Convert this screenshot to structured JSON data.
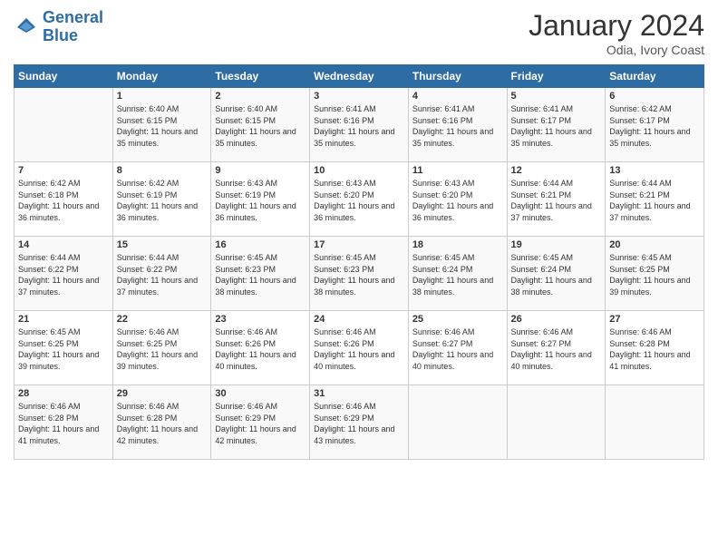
{
  "logo": {
    "line1": "General",
    "line2": "Blue"
  },
  "title": "January 2024",
  "subtitle": "Odia, Ivory Coast",
  "days": [
    "Sunday",
    "Monday",
    "Tuesday",
    "Wednesday",
    "Thursday",
    "Friday",
    "Saturday"
  ],
  "weeks": [
    [
      {
        "num": "",
        "sunrise": "",
        "sunset": "",
        "daylight": ""
      },
      {
        "num": "1",
        "sunrise": "Sunrise: 6:40 AM",
        "sunset": "Sunset: 6:15 PM",
        "daylight": "Daylight: 11 hours and 35 minutes."
      },
      {
        "num": "2",
        "sunrise": "Sunrise: 6:40 AM",
        "sunset": "Sunset: 6:15 PM",
        "daylight": "Daylight: 11 hours and 35 minutes."
      },
      {
        "num": "3",
        "sunrise": "Sunrise: 6:41 AM",
        "sunset": "Sunset: 6:16 PM",
        "daylight": "Daylight: 11 hours and 35 minutes."
      },
      {
        "num": "4",
        "sunrise": "Sunrise: 6:41 AM",
        "sunset": "Sunset: 6:16 PM",
        "daylight": "Daylight: 11 hours and 35 minutes."
      },
      {
        "num": "5",
        "sunrise": "Sunrise: 6:41 AM",
        "sunset": "Sunset: 6:17 PM",
        "daylight": "Daylight: 11 hours and 35 minutes."
      },
      {
        "num": "6",
        "sunrise": "Sunrise: 6:42 AM",
        "sunset": "Sunset: 6:17 PM",
        "daylight": "Daylight: 11 hours and 35 minutes."
      }
    ],
    [
      {
        "num": "7",
        "sunrise": "Sunrise: 6:42 AM",
        "sunset": "Sunset: 6:18 PM",
        "daylight": "Daylight: 11 hours and 36 minutes."
      },
      {
        "num": "8",
        "sunrise": "Sunrise: 6:42 AM",
        "sunset": "Sunset: 6:19 PM",
        "daylight": "Daylight: 11 hours and 36 minutes."
      },
      {
        "num": "9",
        "sunrise": "Sunrise: 6:43 AM",
        "sunset": "Sunset: 6:19 PM",
        "daylight": "Daylight: 11 hours and 36 minutes."
      },
      {
        "num": "10",
        "sunrise": "Sunrise: 6:43 AM",
        "sunset": "Sunset: 6:20 PM",
        "daylight": "Daylight: 11 hours and 36 minutes."
      },
      {
        "num": "11",
        "sunrise": "Sunrise: 6:43 AM",
        "sunset": "Sunset: 6:20 PM",
        "daylight": "Daylight: 11 hours and 36 minutes."
      },
      {
        "num": "12",
        "sunrise": "Sunrise: 6:44 AM",
        "sunset": "Sunset: 6:21 PM",
        "daylight": "Daylight: 11 hours and 37 minutes."
      },
      {
        "num": "13",
        "sunrise": "Sunrise: 6:44 AM",
        "sunset": "Sunset: 6:21 PM",
        "daylight": "Daylight: 11 hours and 37 minutes."
      }
    ],
    [
      {
        "num": "14",
        "sunrise": "Sunrise: 6:44 AM",
        "sunset": "Sunset: 6:22 PM",
        "daylight": "Daylight: 11 hours and 37 minutes."
      },
      {
        "num": "15",
        "sunrise": "Sunrise: 6:44 AM",
        "sunset": "Sunset: 6:22 PM",
        "daylight": "Daylight: 11 hours and 37 minutes."
      },
      {
        "num": "16",
        "sunrise": "Sunrise: 6:45 AM",
        "sunset": "Sunset: 6:23 PM",
        "daylight": "Daylight: 11 hours and 38 minutes."
      },
      {
        "num": "17",
        "sunrise": "Sunrise: 6:45 AM",
        "sunset": "Sunset: 6:23 PM",
        "daylight": "Daylight: 11 hours and 38 minutes."
      },
      {
        "num": "18",
        "sunrise": "Sunrise: 6:45 AM",
        "sunset": "Sunset: 6:24 PM",
        "daylight": "Daylight: 11 hours and 38 minutes."
      },
      {
        "num": "19",
        "sunrise": "Sunrise: 6:45 AM",
        "sunset": "Sunset: 6:24 PM",
        "daylight": "Daylight: 11 hours and 38 minutes."
      },
      {
        "num": "20",
        "sunrise": "Sunrise: 6:45 AM",
        "sunset": "Sunset: 6:25 PM",
        "daylight": "Daylight: 11 hours and 39 minutes."
      }
    ],
    [
      {
        "num": "21",
        "sunrise": "Sunrise: 6:45 AM",
        "sunset": "Sunset: 6:25 PM",
        "daylight": "Daylight: 11 hours and 39 minutes."
      },
      {
        "num": "22",
        "sunrise": "Sunrise: 6:46 AM",
        "sunset": "Sunset: 6:25 PM",
        "daylight": "Daylight: 11 hours and 39 minutes."
      },
      {
        "num": "23",
        "sunrise": "Sunrise: 6:46 AM",
        "sunset": "Sunset: 6:26 PM",
        "daylight": "Daylight: 11 hours and 40 minutes."
      },
      {
        "num": "24",
        "sunrise": "Sunrise: 6:46 AM",
        "sunset": "Sunset: 6:26 PM",
        "daylight": "Daylight: 11 hours and 40 minutes."
      },
      {
        "num": "25",
        "sunrise": "Sunrise: 6:46 AM",
        "sunset": "Sunset: 6:27 PM",
        "daylight": "Daylight: 11 hours and 40 minutes."
      },
      {
        "num": "26",
        "sunrise": "Sunrise: 6:46 AM",
        "sunset": "Sunset: 6:27 PM",
        "daylight": "Daylight: 11 hours and 40 minutes."
      },
      {
        "num": "27",
        "sunrise": "Sunrise: 6:46 AM",
        "sunset": "Sunset: 6:28 PM",
        "daylight": "Daylight: 11 hours and 41 minutes."
      }
    ],
    [
      {
        "num": "28",
        "sunrise": "Sunrise: 6:46 AM",
        "sunset": "Sunset: 6:28 PM",
        "daylight": "Daylight: 11 hours and 41 minutes."
      },
      {
        "num": "29",
        "sunrise": "Sunrise: 6:46 AM",
        "sunset": "Sunset: 6:28 PM",
        "daylight": "Daylight: 11 hours and 42 minutes."
      },
      {
        "num": "30",
        "sunrise": "Sunrise: 6:46 AM",
        "sunset": "Sunset: 6:29 PM",
        "daylight": "Daylight: 11 hours and 42 minutes."
      },
      {
        "num": "31",
        "sunrise": "Sunrise: 6:46 AM",
        "sunset": "Sunset: 6:29 PM",
        "daylight": "Daylight: 11 hours and 43 minutes."
      },
      {
        "num": "",
        "sunrise": "",
        "sunset": "",
        "daylight": ""
      },
      {
        "num": "",
        "sunrise": "",
        "sunset": "",
        "daylight": ""
      },
      {
        "num": "",
        "sunrise": "",
        "sunset": "",
        "daylight": ""
      }
    ]
  ]
}
